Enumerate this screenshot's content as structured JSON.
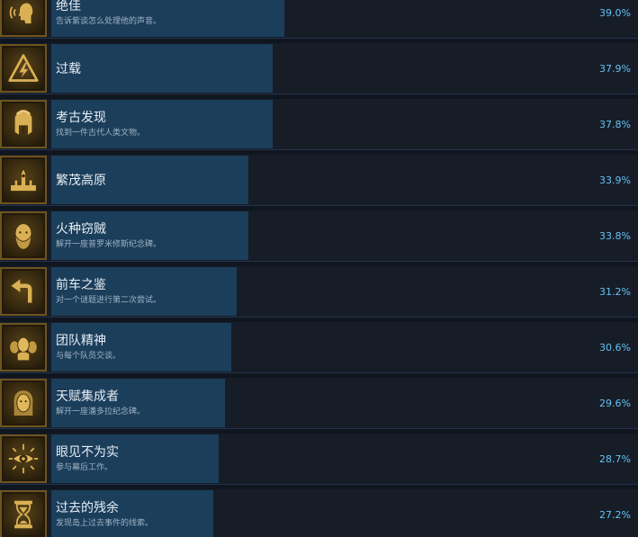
{
  "achievements": [
    {
      "title": "绝佳",
      "desc": "告诉紫谈怎么处理他的声音。",
      "percent": 39.0,
      "percent_label": "39.0%",
      "icon": "speaking-head-icon"
    },
    {
      "title": "过载",
      "desc": "",
      "percent": 37.9,
      "percent_label": "37.9%",
      "icon": "lightning-warning-icon"
    },
    {
      "title": "考古发现",
      "desc": "找到一件古代人类文物。",
      "percent": 37.8,
      "percent_label": "37.8%",
      "icon": "spartan-helmet-icon"
    },
    {
      "title": "繁茂高原",
      "desc": "",
      "percent": 33.9,
      "percent_label": "33.9%",
      "icon": "city-skyline-icon"
    },
    {
      "title": "火种窃贼",
      "desc": "解开一座普罗米修斯纪念碑。",
      "percent": 33.8,
      "percent_label": "33.8%",
      "icon": "bearded-head-icon"
    },
    {
      "title": "前车之鉴",
      "desc": "对一个谜题进行第二次尝试。",
      "percent": 31.2,
      "percent_label": "31.2%",
      "icon": "return-arrow-icon"
    },
    {
      "title": "团队精神",
      "desc": "与每个队员交谈。",
      "percent": 30.6,
      "percent_label": "30.6%",
      "icon": "three-heads-icon"
    },
    {
      "title": "天赋集成者",
      "desc": "解开一座潘多拉纪念碑。",
      "percent": 29.6,
      "percent_label": "29.6%",
      "icon": "female-head-icon"
    },
    {
      "title": "眼见不为实",
      "desc": "参与幕后工作。",
      "percent": 28.7,
      "percent_label": "28.7%",
      "icon": "radiant-eye-icon"
    },
    {
      "title": "过去的残余",
      "desc": "发现岛上过去事件的线索。",
      "percent": 27.2,
      "percent_label": "27.2%",
      "icon": "hourglass-icon"
    }
  ]
}
